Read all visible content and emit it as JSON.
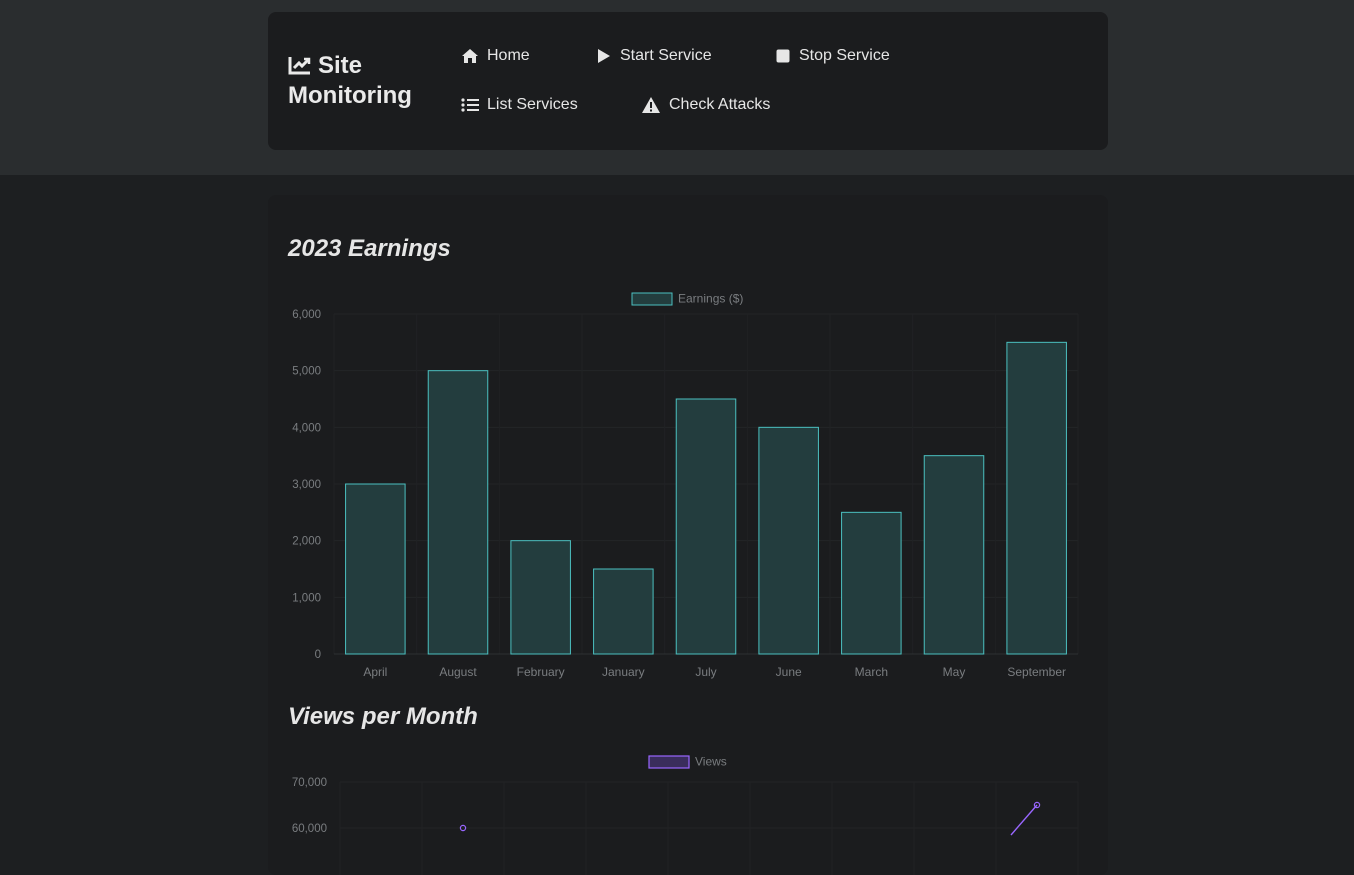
{
  "nav": {
    "brand": "Site Monitoring",
    "items": [
      {
        "label": "Home",
        "icon": "home-icon"
      },
      {
        "label": "Start Service",
        "icon": "play-icon"
      },
      {
        "label": "Stop Service",
        "icon": "stop-icon"
      },
      {
        "label": "List Services",
        "icon": "list-icon"
      },
      {
        "label": "Check Attacks",
        "icon": "warning-icon"
      }
    ]
  },
  "sections": {
    "earnings_title": "2023 Earnings",
    "views_title": "Views per Month"
  },
  "colors": {
    "earnings_fill": "#233d3e",
    "earnings_stroke": "#4bc0c0",
    "views_stroke": "#9966ff",
    "views_fill": "#3a2d5c"
  },
  "chart_data": [
    {
      "type": "bar",
      "title": "2023 Earnings",
      "categories": [
        "April",
        "August",
        "February",
        "January",
        "July",
        "June",
        "March",
        "May",
        "September"
      ],
      "series": [
        {
          "name": "Earnings ($)",
          "values": [
            3000,
            5000,
            2000,
            1500,
            4500,
            4000,
            2500,
            3500,
            5500
          ]
        }
      ],
      "yticks": [
        "0",
        "1,000",
        "2,000",
        "3,000",
        "4,000",
        "5,000",
        "6,000"
      ],
      "ylim": [
        0,
        6000
      ],
      "legend": "top-center",
      "grid": true
    },
    {
      "type": "line",
      "title": "Views per Month",
      "series": [
        {
          "name": "Views",
          "values": [
            null,
            60000,
            null,
            null,
            null,
            null,
            null,
            null,
            65000
          ]
        }
      ],
      "yticks": [
        "70,000",
        "60,000"
      ],
      "legend": "top-center",
      "grid": true
    }
  ]
}
